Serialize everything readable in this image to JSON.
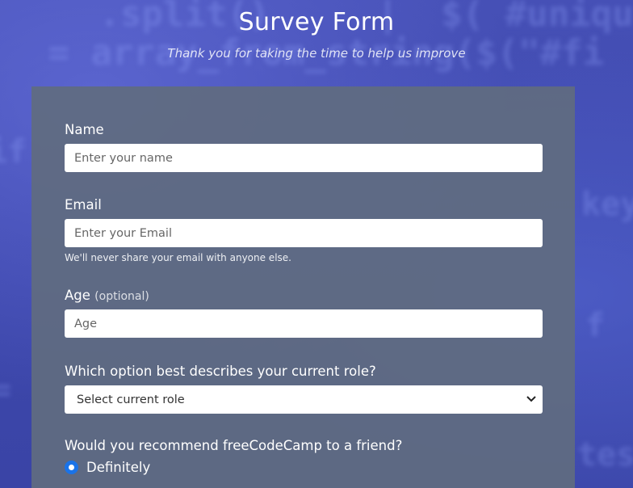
{
  "header": {
    "title": "Survey Form",
    "subtitle": "Thank you for taking the time to help us improve"
  },
  "form": {
    "name": {
      "label": "Name",
      "placeholder": "Enter your name"
    },
    "email": {
      "label": "Email",
      "placeholder": "Enter your Email",
      "hint": "We'll never share your email with anyone else."
    },
    "age": {
      "label": "Age",
      "optional": "(optional)",
      "placeholder": "Age"
    },
    "role": {
      "label": "Which option best describes your current role?",
      "selected": "Select current role",
      "icon": "chevron-down-icon"
    },
    "recommend": {
      "label": "Would you recommend freeCodeCamp to a friend?",
      "option": "Definitely",
      "checked": true
    }
  },
  "colors": {
    "card": "#606c80",
    "background": "#3e48ad",
    "radio": "#1a73e8"
  }
}
